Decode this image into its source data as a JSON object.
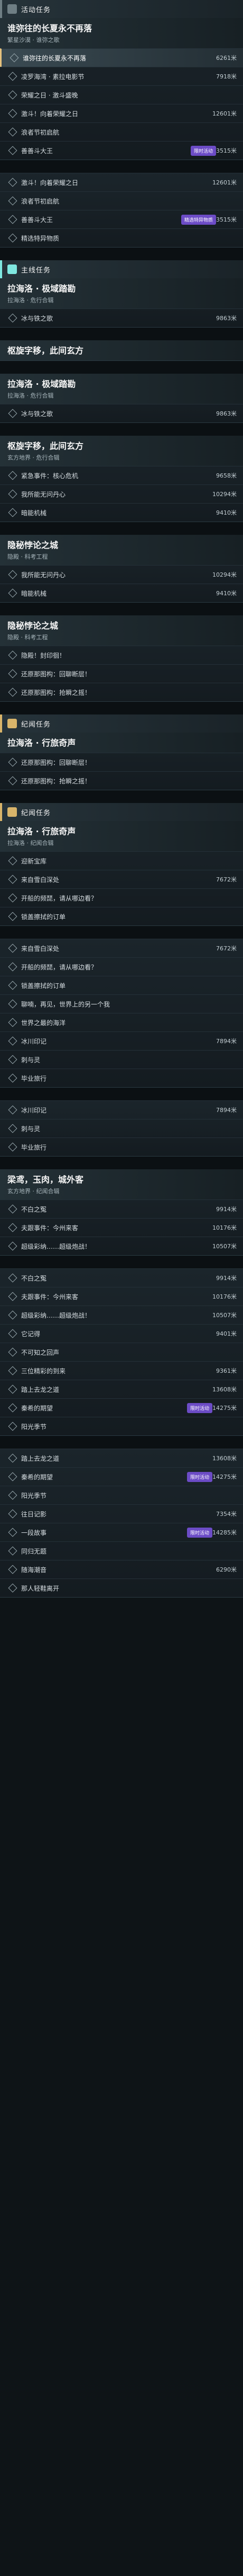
{
  "blocks": [
    {
      "kind": "event",
      "head": {
        "label": "活动任务",
        "accent": "#6f7e84"
      },
      "title": {
        "main": "谁弥往的长夏永不再落",
        "sub": "繁星沙漠 · 谁弥之歌"
      },
      "rows": [
        {
          "label": "谁弥往的长夏永不再落",
          "dist": "6261米",
          "state": "active"
        },
        {
          "label": "凌罗海湾 · 素拉电影节",
          "dist": "7918米",
          "state": "normal"
        },
        {
          "label": "荣耀之日 · 激斗盛晚",
          "dist": "",
          "state": "normal"
        },
        {
          "label": "激斗！向着荣耀之日",
          "dist": "12601米",
          "state": "normal"
        },
        {
          "label": "浪者节初启航",
          "dist": "",
          "state": "normal"
        },
        {
          "label": "善善斗大王",
          "dist": "3515米",
          "state": "normal",
          "pill": "限时活动"
        }
      ]
    },
    {
      "kind": "event2",
      "rows": [
        {
          "label": "激斗！向着荣耀之日",
          "dist": "12601米",
          "state": "normal"
        },
        {
          "label": "浪者节初启航",
          "dist": "",
          "state": "normal"
        },
        {
          "label": "善善斗大王",
          "dist": "3515米",
          "state": "normal",
          "pill": "精选特异物质"
        },
        {
          "label": "精选特异物质",
          "dist": "",
          "state": "normal"
        }
      ]
    },
    {
      "kind": "main",
      "head": {
        "label": "主线任务",
        "accent": "#7fe7e0"
      },
      "title": {
        "main": "拉海洛 · 极域踏勘",
        "sub": "拉海洛 · 危行合辑"
      },
      "rows": [
        {
          "label": "冰与铁之歌",
          "dist": "9863米",
          "state": "normal"
        }
      ]
    },
    {
      "kind": "main2",
      "title": {
        "main": "枢旋字移，此间玄方",
        "sub": ""
      },
      "rows": []
    },
    {
      "kind": "main3",
      "title": {
        "main": "拉海洛 · 极域踏勘",
        "sub": "拉海洛 · 危行合辑"
      },
      "rows": [
        {
          "label": "冰与铁之歌",
          "dist": "9863米",
          "state": "normal"
        }
      ]
    },
    {
      "kind": "main4",
      "title": {
        "main": "枢旋字移，此间玄方",
        "sub": "玄方地界 · 危行合辑"
      },
      "rows": [
        {
          "label": "紧急事件：核心危机",
          "dist": "9658米",
          "state": "normal"
        },
        {
          "label": "我所能无问丹心",
          "dist": "10294米",
          "state": "normal"
        },
        {
          "label": "暗能机械",
          "dist": "9410米",
          "state": "normal"
        }
      ]
    },
    {
      "kind": "main5",
      "title": {
        "main": "隐秘悖论之城",
        "sub": "隐殿 · 科考工程"
      },
      "rows": [
        {
          "label": "我所能无问丹心",
          "dist": "10294米",
          "state": "normal"
        },
        {
          "label": "暗能机械",
          "dist": "9410米",
          "state": "normal"
        }
      ]
    },
    {
      "kind": "main6",
      "title": {
        "main": "隐秘悖论之城",
        "sub": "隐殿 · 科考工程"
      },
      "rows": [
        {
          "label": "隐殿！封印徊！",
          "dist": "",
          "state": "normal"
        },
        {
          "label": "还原那图构：回聊断层！",
          "dist": "",
          "state": "normal"
        },
        {
          "label": "还原那图构：抢瞬之摇！",
          "dist": "",
          "state": "normal"
        }
      ]
    },
    {
      "kind": "legend",
      "head": {
        "label": "纪闻任务",
        "accent": "#d8b46a"
      },
      "title": {
        "main": "拉海洛 · 行旅奇声",
        "sub": ""
      },
      "rows": [
        {
          "label": "还原那图构：回聊断层！",
          "dist": "",
          "state": "normal"
        },
        {
          "label": "还原那图构：抢瞬之摇！",
          "dist": "",
          "state": "normal"
        }
      ]
    },
    {
      "kind": "legend2",
      "head": {
        "label": "纪闻任务",
        "accent": "#d8b46a"
      },
      "title": {
        "main": "拉海洛 · 行旅奇声",
        "sub": "拉海洛 · 纪闻合辑"
      },
      "rows": [
        {
          "label": "迎新宝库",
          "dist": "",
          "state": "normal"
        },
        {
          "label": "来自雪白深处",
          "dist": "7672米",
          "state": "normal"
        },
        {
          "label": "开船的频琵，请从哪边看？",
          "dist": "",
          "state": "normal"
        },
        {
          "label": "锁盖擦拭的订单",
          "dist": "",
          "state": "normal"
        }
      ]
    },
    {
      "kind": "legend3",
      "rows": [
        {
          "label": "来自雪白深处",
          "dist": "7672米",
          "state": "normal"
        },
        {
          "label": "开船的频琵，请从哪边看？",
          "dist": "",
          "state": "normal"
        },
        {
          "label": "锁盖擦拭的订单",
          "dist": "",
          "state": "normal"
        },
        {
          "label": "聊喃，再见，世界上的另一个我",
          "dist": "",
          "state": "normal"
        },
        {
          "label": "世界之最的海洋",
          "dist": "",
          "state": "normal"
        },
        {
          "label": "冰川印记",
          "dist": "7894米",
          "state": "normal"
        },
        {
          "label": "刺与灵",
          "dist": "",
          "state": "normal"
        },
        {
          "label": "毕业旅行",
          "dist": "",
          "state": "normal"
        }
      ]
    },
    {
      "kind": "legend4",
      "rows": [
        {
          "label": "冰川印记",
          "dist": "7894米",
          "state": "normal"
        },
        {
          "label": "刺与灵",
          "dist": "",
          "state": "normal"
        },
        {
          "label": "毕业旅行",
          "dist": "",
          "state": "normal"
        }
      ]
    },
    {
      "kind": "legend5",
      "title": {
        "main": "梁鸢，玉肉，城外客",
        "sub": "玄方地界 · 纪闻合辑"
      },
      "rows": [
        {
          "label": "不白之冤",
          "dist": "9914米",
          "state": "normal"
        },
        {
          "label": "夫跟事件：今州来客",
          "dist": "10176米",
          "state": "normal"
        },
        {
          "label": "超级彩纳……超级炮战！",
          "dist": "10507米",
          "state": "normal"
        }
      ]
    },
    {
      "kind": "legend6",
      "rows": [
        {
          "label": "不白之冤",
          "dist": "9914米",
          "state": "normal"
        },
        {
          "label": "夫跟事件：今州来客",
          "dist": "10176米",
          "state": "normal"
        },
        {
          "label": "超级彩纳……超级炮战！",
          "dist": "10507米",
          "state": "normal"
        },
        {
          "label": "它记得",
          "dist": "9401米",
          "state": "normal"
        },
        {
          "label": "不可知之回声",
          "dist": "",
          "state": "normal"
        },
        {
          "label": "三位精彩的到来",
          "dist": "9361米",
          "state": "normal"
        },
        {
          "label": "踏上去龙之道",
          "dist": "13608米",
          "state": "normal"
        },
        {
          "label": "秦希的期望",
          "dist": "14275米",
          "state": "normal",
          "pill": "限时活动"
        },
        {
          "label": "阳光季节",
          "dist": "",
          "state": "normal"
        }
      ]
    },
    {
      "kind": "legend7",
      "rows": [
        {
          "label": "踏上去龙之道",
          "dist": "13608米",
          "state": "normal"
        },
        {
          "label": "秦希的期望",
          "dist": "14275米",
          "state": "normal",
          "pill": "限时活动"
        },
        {
          "label": "阳光季节",
          "dist": "",
          "state": "normal"
        },
        {
          "label": "往日记影",
          "dist": "7354米",
          "state": "normal"
        },
        {
          "label": "一段故事",
          "dist": "14285米",
          "state": "normal",
          "pill": "限时活动"
        },
        {
          "label": "同归无题",
          "dist": "",
          "state": "normal"
        },
        {
          "label": "随海潮音",
          "dist": "6290米",
          "state": "normal"
        },
        {
          "label": "那人轻鞋离开",
          "dist": "",
          "state": "normal"
        }
      ]
    }
  ]
}
